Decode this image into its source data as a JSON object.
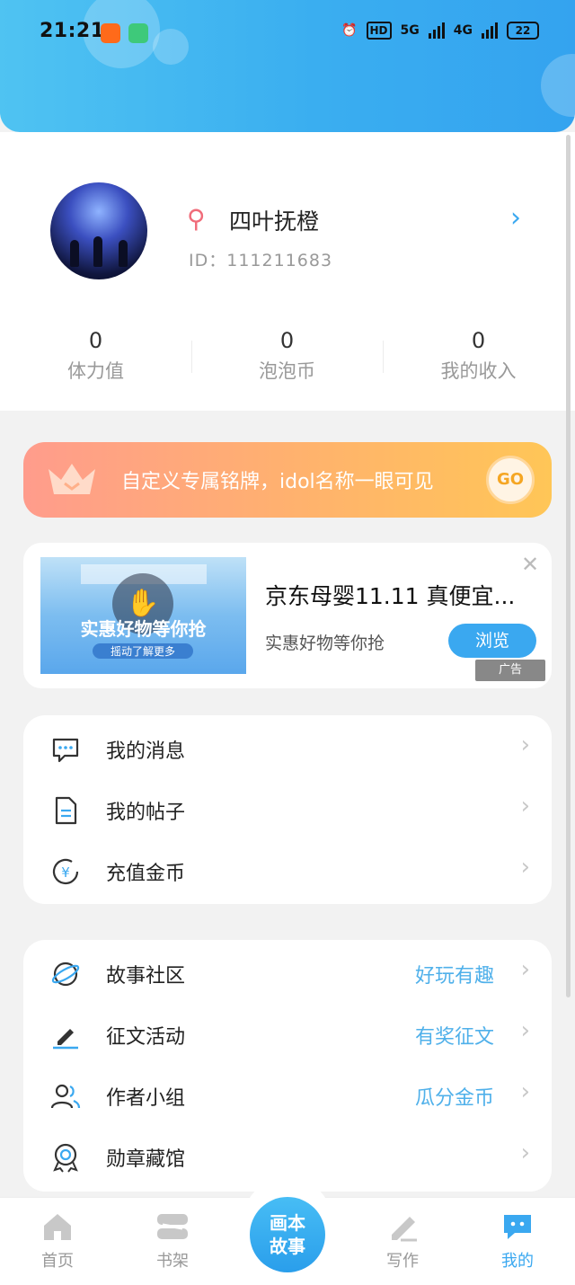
{
  "status_bar": {
    "time": "21:21",
    "network_hd": "HD",
    "network_5g": "5G",
    "network_4g": "4G",
    "battery": "22"
  },
  "profile": {
    "username": "四叶抚橙",
    "id_text": "ID：111211683",
    "gender_icon": "female-icon",
    "stats": [
      {
        "value": "0",
        "label": "体力值"
      },
      {
        "value": "0",
        "label": "泡泡币"
      },
      {
        "value": "0",
        "label": "我的收入"
      }
    ]
  },
  "banner": {
    "text": "自定义专属铭牌，idol名称一眼可见",
    "go_label": "GO"
  },
  "ad": {
    "image_text": "实惠好物等你抢",
    "image_sub": "摇动了解更多",
    "title": "京东母婴11.11 真便宜...",
    "description": "实惠好物等你抢",
    "button": "浏览",
    "ad_label": "广告"
  },
  "menu_group_1": [
    {
      "label": "我的消息",
      "icon": "message-icon"
    },
    {
      "label": "我的帖子",
      "icon": "document-icon"
    },
    {
      "label": "充值金币",
      "icon": "yuan-coin-icon"
    }
  ],
  "menu_group_2": [
    {
      "label": "故事社区",
      "hint": "好玩有趣",
      "icon": "planet-icon"
    },
    {
      "label": "征文活动",
      "hint": "有奖征文",
      "icon": "pen-icon"
    },
    {
      "label": "作者小组",
      "hint": "瓜分金币",
      "icon": "group-icon"
    },
    {
      "label": "勋章藏馆",
      "hint": "",
      "icon": "medal-icon"
    }
  ],
  "bottom_nav": {
    "items": [
      {
        "label": "首页",
        "icon": "home-icon"
      },
      {
        "label": "书架",
        "icon": "bookshelf-icon"
      },
      {
        "label": "写作",
        "icon": "write-icon"
      },
      {
        "label": "我的",
        "icon": "chat-bubble-icon"
      }
    ],
    "center_label_line1": "画本",
    "center_label_line2": "故事"
  },
  "colors": {
    "accent": "#3aa8f0",
    "hint": "#4fb0ea",
    "banner_start": "#ff9c8c",
    "banner_end": "#ffc657"
  }
}
